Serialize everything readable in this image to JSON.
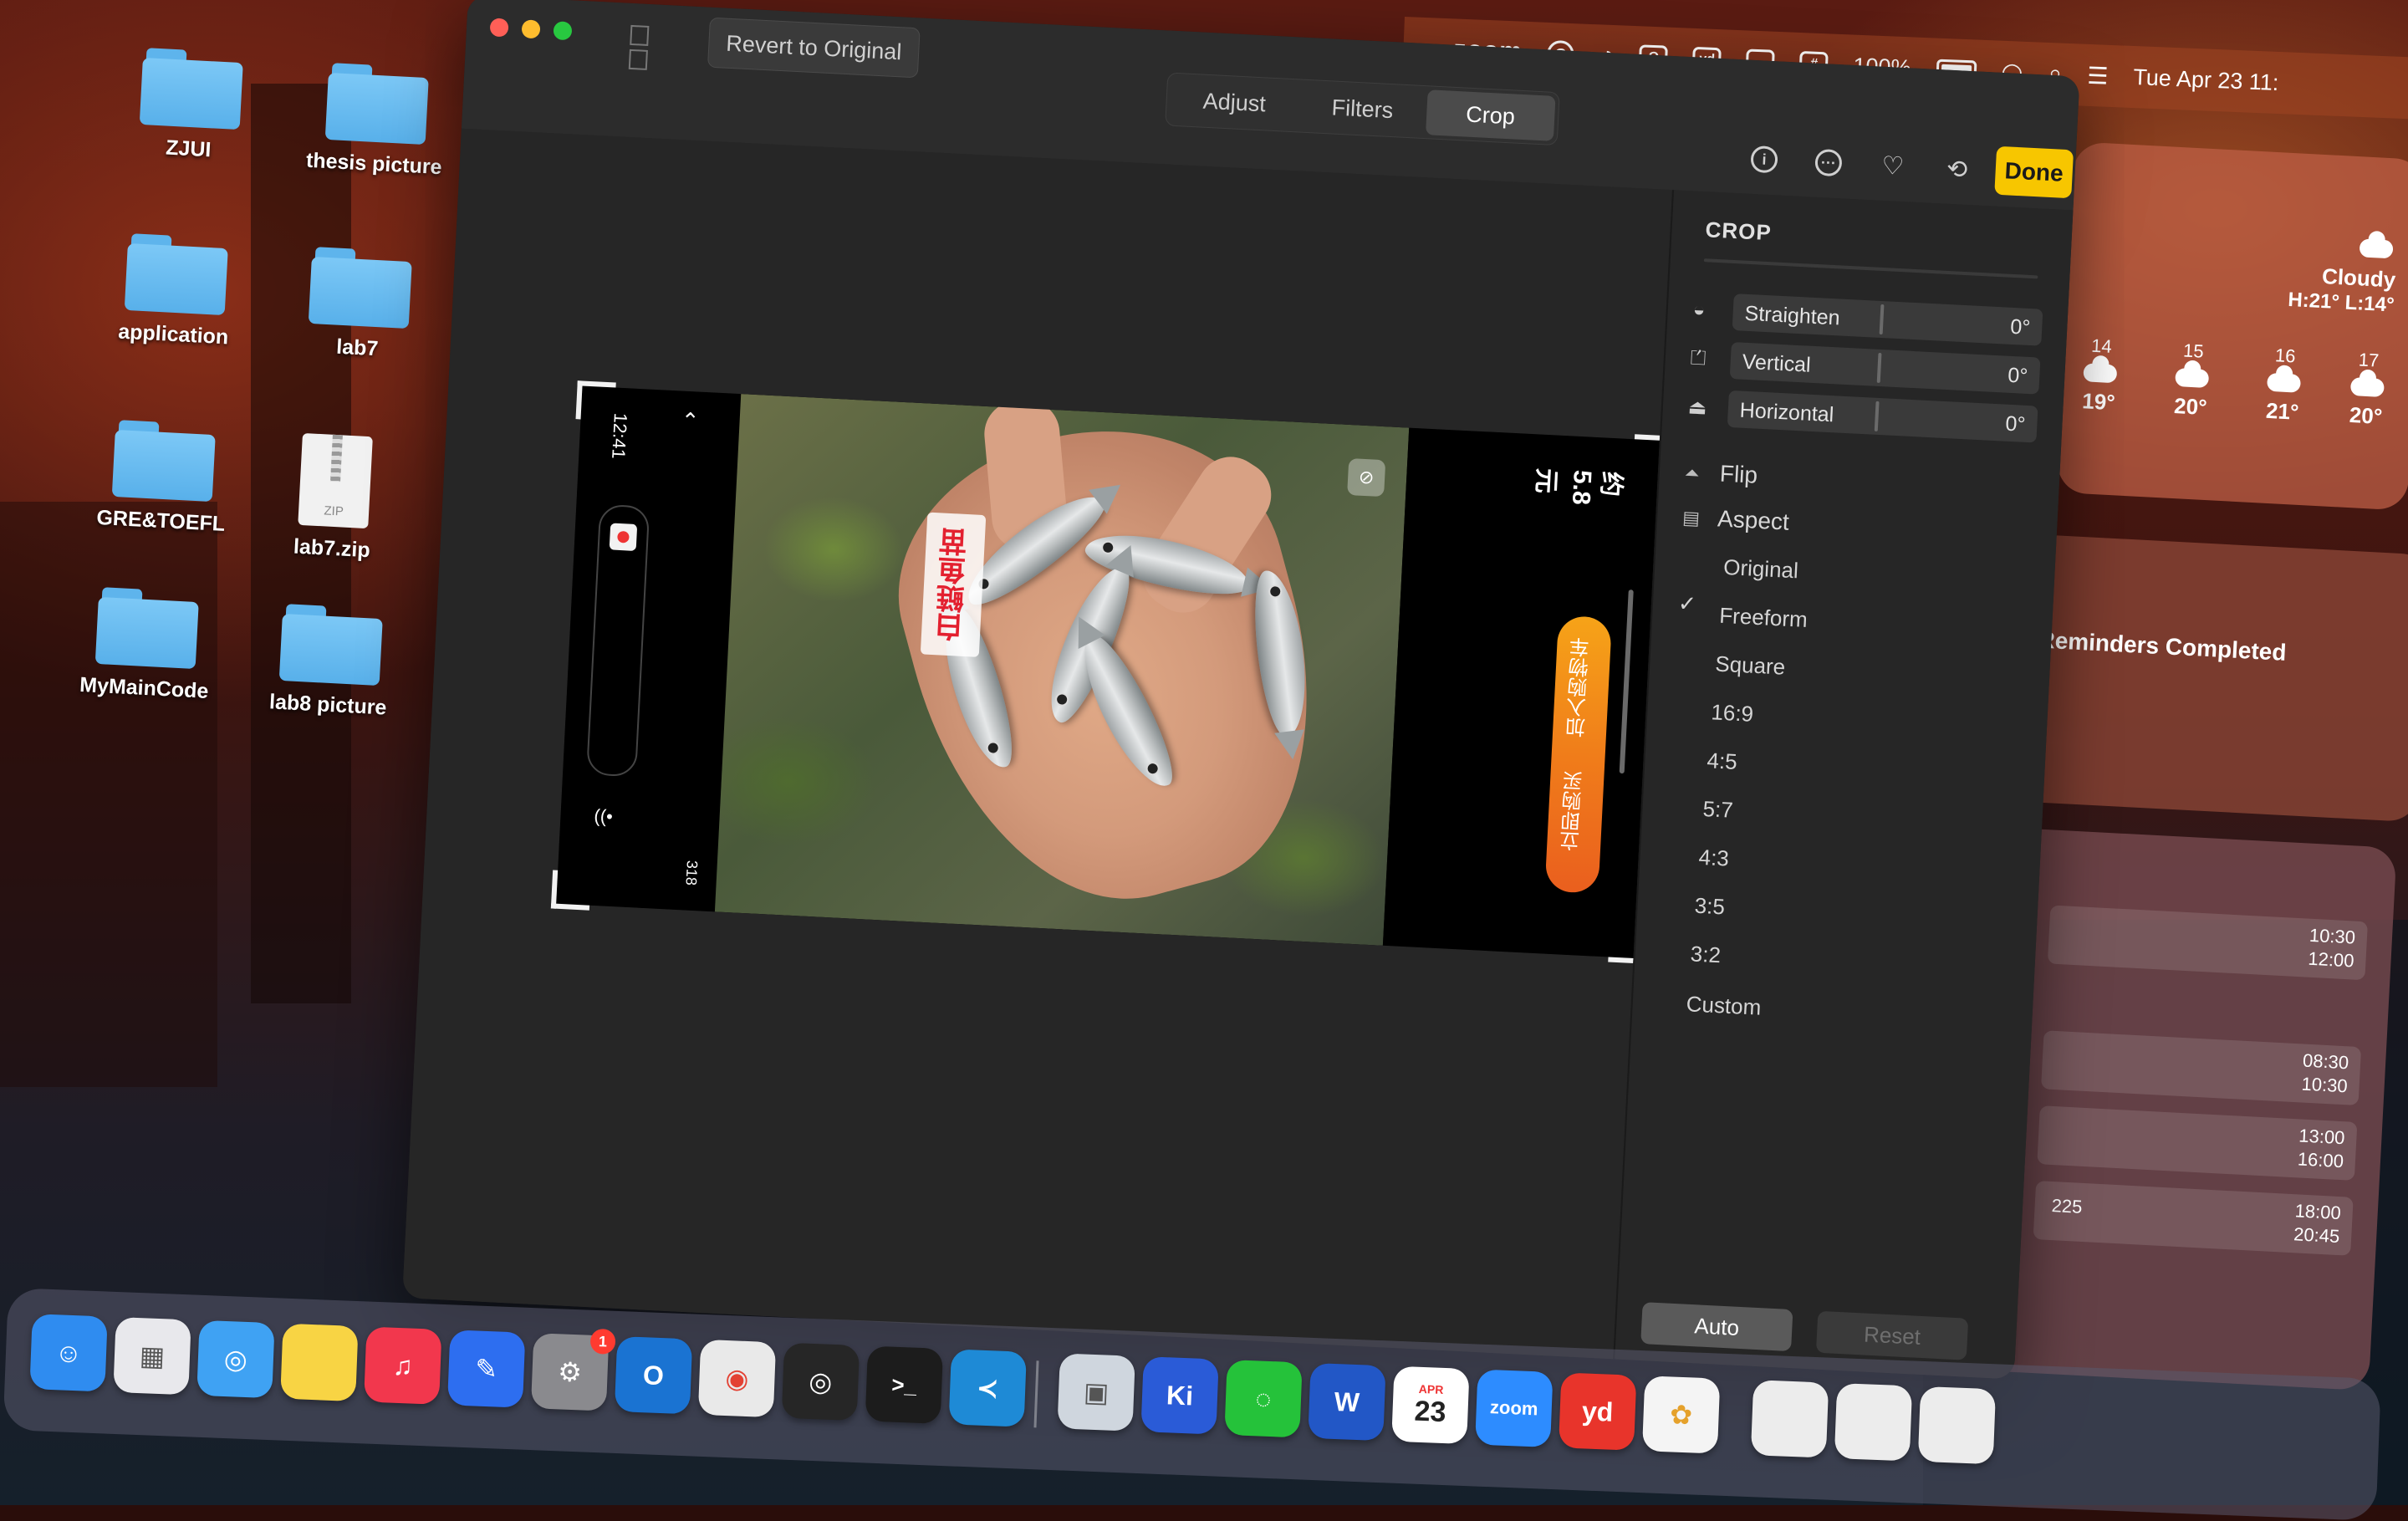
{
  "menubar": {
    "zoom": "zoom",
    "yd": "yd",
    "hash": "#",
    "battery": "100%",
    "datetime": "Tue Apr 23  11:",
    "icons": [
      "grammarly-icon",
      "wechat-icon",
      "outlook-icon",
      "youdao-icon",
      "display-icon",
      "hashtag-icon",
      "battery-icon",
      "wifi-icon",
      "search-icon",
      "control-center-icon"
    ]
  },
  "desktop": {
    "items": [
      {
        "label": "ZJUI",
        "type": "folder"
      },
      {
        "label": "thesis picture",
        "type": "folder"
      },
      {
        "label": "application",
        "type": "folder"
      },
      {
        "label": "lab7",
        "type": "folder"
      },
      {
        "label": "GRE&TOEFL",
        "type": "folder"
      },
      {
        "label": "lab7.zip",
        "type": "zip"
      },
      {
        "label": "MyMainCode",
        "type": "folder"
      },
      {
        "label": "lab8 picture",
        "type": "folder"
      }
    ],
    "zip_badge": "ZIP"
  },
  "weather": {
    "condition": "Cloudy",
    "hilo": "H:21° L:14°",
    "forecast": [
      {
        "hour": "14",
        "temp": "19°"
      },
      {
        "hour": "15",
        "temp": "20°"
      },
      {
        "hour": "16",
        "temp": "21°"
      },
      {
        "hour": "17",
        "temp": "20°"
      }
    ]
  },
  "reminders": {
    "text": "l Reminders Completed"
  },
  "calendar": {
    "events": [
      {
        "start": "10:30",
        "end": "12:00",
        "note": ""
      },
      {
        "start": "08:30",
        "end": "10:30",
        "note": ""
      },
      {
        "start": "13:00",
        "end": "16:00",
        "note": ""
      },
      {
        "start": "18:00",
        "end": "20:45",
        "note": "225"
      }
    ]
  },
  "photos": {
    "revert_label": "Revert to Original",
    "tabs": [
      {
        "label": "Adjust",
        "active": false
      },
      {
        "label": "Filters",
        "active": false
      },
      {
        "label": "Crop",
        "active": true
      }
    ],
    "toolbar": {
      "info_icon": "i",
      "more_icon": "···",
      "done_label": "Done"
    },
    "image": {
      "overlay_caption": "白鲢鱼苗",
      "top_left_time": "12:41",
      "side_number": "318",
      "right_info": "约5.8元",
      "cta_top": "加入购物车",
      "cta_bottom": "立即购买"
    },
    "sidebar": {
      "title": "CROP",
      "adjustments": [
        {
          "label": "Straighten",
          "value": "0°",
          "icon": "straighten-icon",
          "glyph": "◒"
        },
        {
          "label": "Vertical",
          "value": "0°",
          "icon": "vertical-perspective-icon",
          "glyph": "⏍"
        },
        {
          "label": "Horizontal",
          "value": "0°",
          "icon": "horizontal-perspective-icon",
          "glyph": "⏏"
        }
      ],
      "flip_label": "Flip",
      "aspect_label": "Aspect",
      "aspect_options": [
        "Original",
        "Freeform",
        "Square",
        "16:9",
        "4:5",
        "5:7",
        "4:3",
        "3:5",
        "3:2",
        "Custom"
      ],
      "aspect_selected": "Freeform",
      "check": "✓",
      "auto_label": "Auto",
      "reset_label": "Reset"
    }
  },
  "dock": {
    "apps": [
      {
        "name": "Finder",
        "color": "#2f8cf0",
        "glyph": "☺"
      },
      {
        "name": "Launchpad",
        "color": "#e8e8ec",
        "glyph": ""
      },
      {
        "name": "Safari",
        "color": "#3fa2f3",
        "glyph": "⊘"
      },
      {
        "name": "Notes",
        "color": "#f8d444",
        "glyph": ""
      },
      {
        "name": "Music",
        "color": "#f2374d",
        "glyph": "♫"
      },
      {
        "name": "Pencil",
        "color": "#2d6ef0",
        "glyph": "✎"
      },
      {
        "name": "System Settings",
        "color": "#8a8a8e",
        "glyph": "⚙",
        "badge": "1"
      },
      {
        "name": "Outlook",
        "color": "#1a73d2",
        "glyph": "O"
      },
      {
        "name": "Chrome",
        "color": "#e9e9e9",
        "glyph": "◉"
      },
      {
        "name": "Scrobbler",
        "color": "#262626",
        "glyph": "◎"
      },
      {
        "name": "Terminal",
        "color": "#1c1c1c",
        "glyph": ">_"
      },
      {
        "name": "VS Code",
        "color": "#1e8ad6",
        "glyph": "≺"
      },
      {
        "name": "Preview",
        "color": "#cfd6de",
        "glyph": "▣"
      },
      {
        "name": "Keynote",
        "color": "#2a5bd7",
        "glyph": "Ki"
      },
      {
        "name": "WeChat",
        "color": "#25c23a",
        "glyph": "◌"
      },
      {
        "name": "Word",
        "color": "#2257c6",
        "glyph": "W"
      },
      {
        "name": "Calendar",
        "color": "#ffffff",
        "glyph": "23",
        "sub": "APR"
      },
      {
        "name": "Zoom",
        "color": "#2d8cff",
        "glyph": "zoom"
      },
      {
        "name": "Youdao",
        "color": "#e8342b",
        "glyph": "yd"
      },
      {
        "name": "Photos",
        "color": "#f4f4f4",
        "glyph": "✿"
      }
    ]
  }
}
